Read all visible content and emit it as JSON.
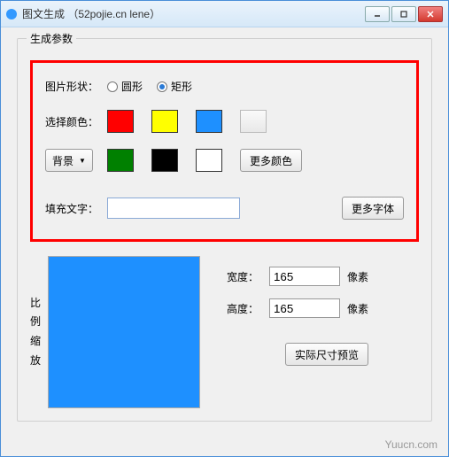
{
  "window": {
    "title": "图文生成 （52pojie.cn lene）"
  },
  "group": {
    "legend": "生成参数"
  },
  "shape": {
    "label": "图片形状：",
    "options": {
      "circle": "圆形",
      "rect": "矩形"
    },
    "selected": "rect"
  },
  "colors": {
    "label": "选择颜色：",
    "row1": [
      "#ff0000",
      "#ffff00",
      "#1e90ff"
    ],
    "bg_label": "背景",
    "row2": [
      "#008000",
      "#000000",
      "#ffffff"
    ],
    "more_color": "更多颜色"
  },
  "text": {
    "label": "填充文字：",
    "value": "",
    "more_font": "更多字体"
  },
  "scale": {
    "chars": [
      "比",
      "例",
      "缩",
      "放"
    ]
  },
  "dims": {
    "width_label": "宽度：",
    "height_label": "高度：",
    "width": "165",
    "height": "165",
    "unit": "像素"
  },
  "preview_btn": "实际尺寸预览",
  "preview_color": "#1e90ff",
  "watermark": "Yuucn.com"
}
